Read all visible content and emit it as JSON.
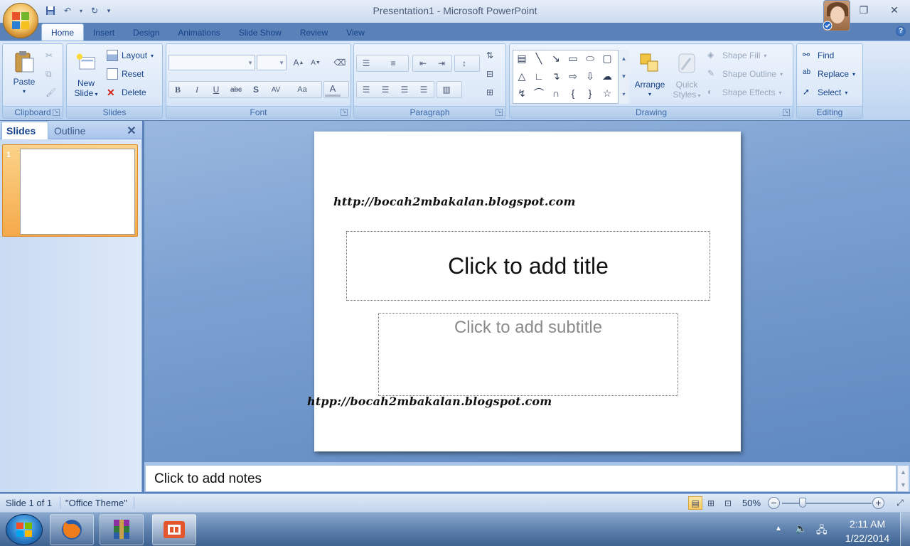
{
  "window": {
    "title": "Presentation1 - Microsoft PowerPoint"
  },
  "tabs": [
    "Home",
    "Insert",
    "Design",
    "Animations",
    "Slide Show",
    "Review",
    "View"
  ],
  "ribbon": {
    "clipboard": {
      "label": "Clipboard",
      "paste": "Paste"
    },
    "slides": {
      "label": "Slides",
      "new_slide_1": "New",
      "new_slide_2": "Slide",
      "layout": "Layout",
      "reset": "Reset",
      "delete": "Delete"
    },
    "font": {
      "label": "Font"
    },
    "paragraph": {
      "label": "Paragraph"
    },
    "drawing": {
      "label": "Drawing",
      "arrange": "Arrange",
      "quick_1": "Quick",
      "quick_2": "Styles",
      "shape_fill": "Shape Fill",
      "shape_outline": "Shape Outline",
      "shape_effects": "Shape Effects"
    },
    "editing": {
      "label": "Editing",
      "find": "Find",
      "replace": "Replace",
      "select": "Select"
    }
  },
  "left_pane": {
    "tab_slides": "Slides",
    "tab_outline": "Outline",
    "close": "✕",
    "thumb_number": "1"
  },
  "slide": {
    "watermark_top": "http://bocah2mbakalan.blogspot.com",
    "title_placeholder": "Click to add title",
    "subtitle_placeholder": "Click to add subtitle",
    "watermark_bottom": "htpp://bocah2mbakalan.blogspot.com"
  },
  "notes": {
    "placeholder": "Click to add notes"
  },
  "status": {
    "slide_info": "Slide 1 of 1",
    "theme": "\"Office Theme\"",
    "zoom": "50%"
  },
  "zoom_level": 0.5,
  "taskbar": {
    "time": "2:11 AM",
    "date": "1/22/2014"
  },
  "colors": {
    "accent": "#15428b",
    "ribbon": "#dbe8f8",
    "selection": "#f5a94a"
  }
}
